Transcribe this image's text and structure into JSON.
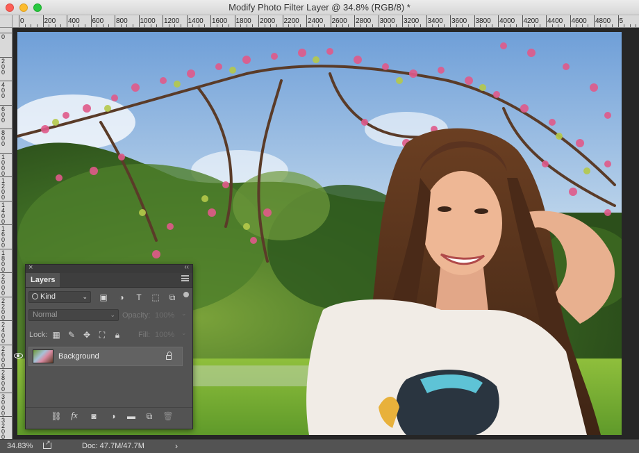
{
  "window": {
    "title": "Modify Photo Filter Layer @ 34.8% (RGB/8) *"
  },
  "ruler": {
    "top_labels": [
      "0",
      "200",
      "400",
      "600",
      "800",
      "1000",
      "1200",
      "1400",
      "1600",
      "1800",
      "2000",
      "2200",
      "2400",
      "2600",
      "2800",
      "3000",
      "3200",
      "3400",
      "3600",
      "3800",
      "4000",
      "4200",
      "4400",
      "4600",
      "4800",
      "5"
    ],
    "left_labels": [
      "0",
      "2\n0\n0",
      "4\n0\n0",
      "6\n0\n0",
      "8\n0\n0",
      "1\n0\n0\n0",
      "1\n2\n0\n0",
      "1\n4\n0\n0",
      "1\n6\n0\n0",
      "1\n8\n0\n0",
      "2\n0\n0\n0",
      "2\n2\n0\n0",
      "2\n4\n0\n0",
      "2\n6\n0\n0",
      "2\n8\n0\n0",
      "3\n0\n0\n0",
      "3\n2\n0\n0"
    ]
  },
  "layers_panel": {
    "tab_label": "Layers",
    "filter_kind": "Kind",
    "blend_mode": "Normal",
    "opacity_label": "Opacity:",
    "opacity_value": "100%",
    "lock_label": "Lock:",
    "fill_label": "Fill:",
    "fill_value": "100%",
    "layers": [
      {
        "name": "Background",
        "visible": true,
        "locked": true
      }
    ]
  },
  "status": {
    "zoom": "34.83%",
    "doc": "Doc: 47.7M/47.7M"
  },
  "colors": {
    "panel_bg": "#535353",
    "canvas_bg": "#262626",
    "ruler_bg": "#d9d9d9"
  }
}
